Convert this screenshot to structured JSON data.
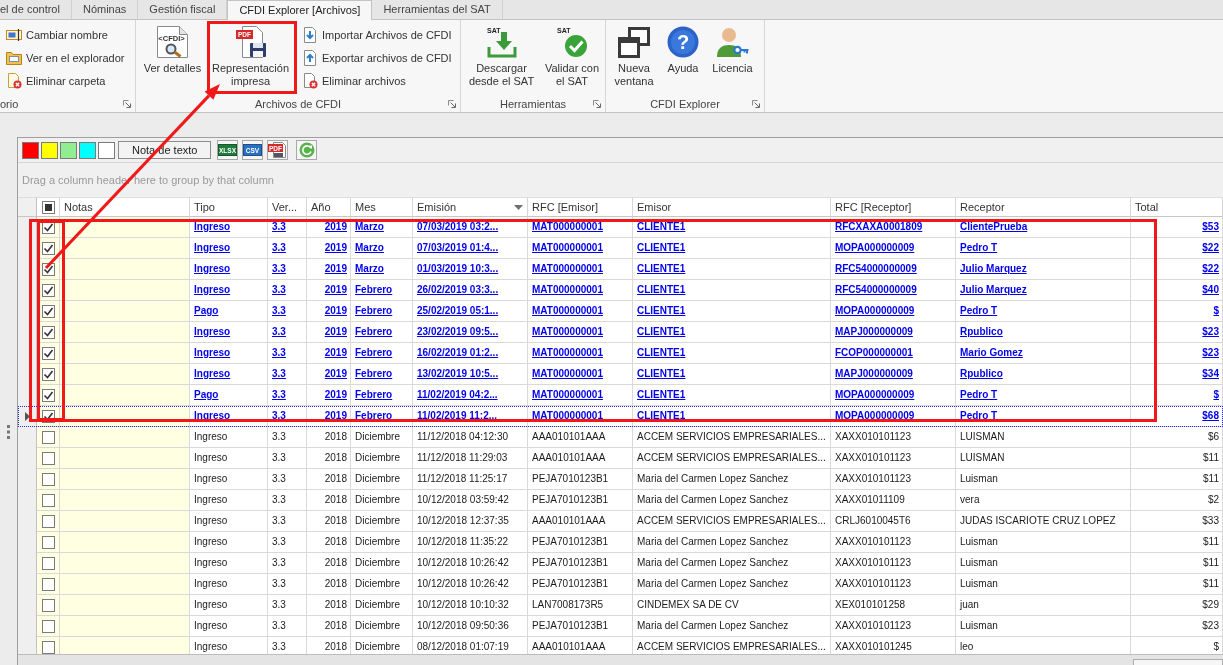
{
  "tabs": [
    {
      "label": "el de control",
      "selected": false
    },
    {
      "label": "Nóminas",
      "selected": false
    },
    {
      "label": "Gestión fiscal",
      "selected": false
    },
    {
      "label": "CFDI Explorer [Archivos]",
      "selected": true
    },
    {
      "label": "Herramientas del SAT",
      "selected": false
    }
  ],
  "ribbon": {
    "groups": [
      {
        "label": "orio",
        "items": [
          {
            "kind": "small",
            "label": "Cambiar nombre"
          },
          {
            "kind": "small",
            "label": "Ver en el explorador"
          },
          {
            "kind": "small",
            "label": "Eliminar carpeta"
          }
        ]
      },
      {
        "label": "Archivos de CFDI",
        "items": [
          {
            "kind": "large",
            "label": "Ver detalles",
            "badge": "<CFDI>"
          },
          {
            "kind": "large",
            "label": "Representación impresa",
            "badge": "PDF"
          },
          {
            "kind": "small",
            "label": "Importar Archivos de CFDI"
          },
          {
            "kind": "small",
            "label": "Exportar archivos de CFDI"
          },
          {
            "kind": "small",
            "label": "Eliminar archivos"
          }
        ]
      },
      {
        "label": "Herramientas",
        "items": [
          {
            "kind": "large",
            "label": "Descargar desde el SAT",
            "badge": "SAT"
          },
          {
            "kind": "large",
            "label": "Validar con el SAT",
            "badge": "SAT"
          }
        ]
      },
      {
        "label": "CFDI Explorer",
        "items": [
          {
            "kind": "large",
            "label": "Nueva ventana"
          },
          {
            "kind": "large",
            "label": "Ayuda",
            "badge": "?"
          },
          {
            "kind": "large",
            "label": "Licencia"
          }
        ]
      }
    ]
  },
  "toolbar": {
    "swatches": [
      {
        "color": "#ff0000"
      },
      {
        "color": "#ffff00"
      },
      {
        "color": "#90ee90"
      },
      {
        "color": "#00ffff"
      },
      {
        "color": "#ffffff"
      }
    ],
    "note_button": "Nota de texto",
    "exports": [
      {
        "badge": "XLSX"
      },
      {
        "badge": "CSV"
      },
      {
        "badge": "PDF"
      }
    ]
  },
  "group_panel": {
    "hint": "Drag a column header here to group by that column"
  },
  "grid": {
    "select_all": {
      "checked": false,
      "partial": true
    },
    "notes_header": "Notas",
    "columns": [
      {
        "label": "Tipo",
        "kind": "text",
        "sorted": false
      },
      {
        "label": "Ver...",
        "kind": "text",
        "sorted": false
      },
      {
        "label": "Año",
        "kind": "number",
        "sorted": false
      },
      {
        "label": "Mes",
        "kind": "text",
        "sorted": false
      },
      {
        "label": "Emisión",
        "kind": "text",
        "sorted": true
      },
      {
        "label": "RFC [Emisor]",
        "kind": "text",
        "sorted": false
      },
      {
        "label": "Emisor",
        "kind": "text",
        "sorted": false
      },
      {
        "label": "RFC [Receptor]",
        "kind": "text",
        "sorted": false
      },
      {
        "label": "Receptor",
        "kind": "text",
        "sorted": false
      },
      {
        "label": "Total",
        "kind": "number",
        "sorted": false
      }
    ],
    "rows": [
      {
        "checked": true,
        "focused": false,
        "cells": [
          "Ingreso",
          "3.3",
          "2019",
          "Marzo",
          "07/03/2019 03:2...",
          "MAT000000001",
          "CLIENTE1",
          "RFCXAXA0001809",
          "ClientePrueba",
          "$53"
        ]
      },
      {
        "checked": true,
        "focused": false,
        "cells": [
          "Ingreso",
          "3.3",
          "2019",
          "Marzo",
          "07/03/2019 01:4...",
          "MAT000000001",
          "CLIENTE1",
          "MOPA000000009",
          "Pedro T",
          "$22"
        ]
      },
      {
        "checked": true,
        "focused": false,
        "cells": [
          "Ingreso",
          "3.3",
          "2019",
          "Marzo",
          "01/03/2019 10:3...",
          "MAT000000001",
          "CLIENTE1",
          "RFC54000000009",
          "Julio Marquez",
          "$22"
        ]
      },
      {
        "checked": true,
        "focused": false,
        "cells": [
          "Ingreso",
          "3.3",
          "2019",
          "Febrero",
          "26/02/2019 03:3...",
          "MAT000000001",
          "CLIENTE1",
          "RFC54000000009",
          "Julio Marquez",
          "$40"
        ]
      },
      {
        "checked": true,
        "focused": false,
        "cells": [
          "Pago",
          "3.3",
          "2019",
          "Febrero",
          "25/02/2019 05:1...",
          "MAT000000001",
          "CLIENTE1",
          "MOPA000000009",
          "Pedro T",
          "$"
        ]
      },
      {
        "checked": true,
        "focused": false,
        "cells": [
          "Ingreso",
          "3.3",
          "2019",
          "Febrero",
          "23/02/2019 09:5...",
          "MAT000000001",
          "CLIENTE1",
          "MAPJ000000009",
          "Rpublico",
          "$23"
        ]
      },
      {
        "checked": true,
        "focused": false,
        "cells": [
          "Ingreso",
          "3.3",
          "2019",
          "Febrero",
          "16/02/2019 01:2...",
          "MAT000000001",
          "CLIENTE1",
          "FCOP000000001",
          "Mario Gomez",
          "$23"
        ]
      },
      {
        "checked": true,
        "focused": false,
        "cells": [
          "Ingreso",
          "3.3",
          "2019",
          "Febrero",
          "13/02/2019 10:5...",
          "MAT000000001",
          "CLIENTE1",
          "MAPJ000000009",
          "Rpublico",
          "$34"
        ]
      },
      {
        "checked": true,
        "focused": false,
        "cells": [
          "Pago",
          "3.3",
          "2019",
          "Febrero",
          "11/02/2019 04:2...",
          "MAT000000001",
          "CLIENTE1",
          "MOPA000000009",
          "Pedro T",
          "$"
        ]
      },
      {
        "checked": true,
        "focused": true,
        "cells": [
          "Ingreso",
          "3.3",
          "2019",
          "Febrero",
          "11/02/2019 11:2...",
          "MAT000000001",
          "CLIENTE1",
          "MOPA000000009",
          "Pedro T",
          "$68"
        ]
      },
      {
        "checked": false,
        "focused": false,
        "cells": [
          "Ingreso",
          "3.3",
          "2018",
          "Diciembre",
          "11/12/2018 04:12:30",
          "AAA010101AAA",
          "ACCEM SERVICIOS EMPRESARIALES...",
          "XAXX010101123",
          "LUISMAN",
          "$6"
        ]
      },
      {
        "checked": false,
        "focused": false,
        "cells": [
          "Ingreso",
          "3.3",
          "2018",
          "Diciembre",
          "11/12/2018 11:29:03",
          "AAA010101AAA",
          "ACCEM SERVICIOS EMPRESARIALES...",
          "XAXX010101123",
          "LUISMAN",
          "$11"
        ]
      },
      {
        "checked": false,
        "focused": false,
        "cells": [
          "Ingreso",
          "3.3",
          "2018",
          "Diciembre",
          "11/12/2018 11:25:17",
          "PEJA7010123B1",
          "Maria del Carmen Lopez Sanchez",
          "XAXX010101123",
          "Luisman",
          "$11"
        ]
      },
      {
        "checked": false,
        "focused": false,
        "cells": [
          "Ingreso",
          "3.3",
          "2018",
          "Diciembre",
          "10/12/2018 03:59:42",
          "PEJA7010123B1",
          "Maria del Carmen Lopez Sanchez",
          "XAXX01011109",
          "vera",
          "$2"
        ]
      },
      {
        "checked": false,
        "focused": false,
        "cells": [
          "Ingreso",
          "3.3",
          "2018",
          "Diciembre",
          "10/12/2018 12:37:35",
          "AAA010101AAA",
          "ACCEM SERVICIOS EMPRESARIALES...",
          "CRLJ6010045T6",
          "JUDAS ISCARIOTE CRUZ LOPEZ",
          "$33"
        ]
      },
      {
        "checked": false,
        "focused": false,
        "cells": [
          "Ingreso",
          "3.3",
          "2018",
          "Diciembre",
          "10/12/2018 11:35:22",
          "PEJA7010123B1",
          "Maria del Carmen Lopez Sanchez",
          "XAXX010101123",
          "Luisman",
          "$11"
        ]
      },
      {
        "checked": false,
        "focused": false,
        "cells": [
          "Ingreso",
          "3.3",
          "2018",
          "Diciembre",
          "10/12/2018 10:26:42",
          "PEJA7010123B1",
          "Maria del Carmen Lopez Sanchez",
          "XAXX010101123",
          "Luisman",
          "$11"
        ]
      },
      {
        "checked": false,
        "focused": false,
        "cells": [
          "Ingreso",
          "3.3",
          "2018",
          "Diciembre",
          "10/12/2018 10:26:42",
          "PEJA7010123B1",
          "Maria del Carmen Lopez Sanchez",
          "XAXX010101123",
          "Luisman",
          "$11"
        ]
      },
      {
        "checked": false,
        "focused": false,
        "cells": [
          "Ingreso",
          "3.3",
          "2018",
          "Diciembre",
          "10/12/2018 10:10:32",
          "LAN7008173R5",
          "CINDEMEX SA DE CV",
          "XEX010101258",
          "juan",
          "$29"
        ]
      },
      {
        "checked": false,
        "focused": false,
        "cells": [
          "Ingreso",
          "3.3",
          "2018",
          "Diciembre",
          "10/12/2018 09:50:36",
          "PEJA7010123B1",
          "Maria del Carmen Lopez Sanchez",
          "XAXX010101123",
          "Luisman",
          "$23"
        ]
      },
      {
        "checked": false,
        "focused": false,
        "cells": [
          "Ingreso",
          "3.3",
          "2018",
          "Diciembre",
          "08/12/2018 01:07:19",
          "AAA010101AAA",
          "ACCEM SERVICIOS EMPRESARIALES...",
          "XAXX010101245",
          "leo",
          "$"
        ]
      }
    ]
  }
}
